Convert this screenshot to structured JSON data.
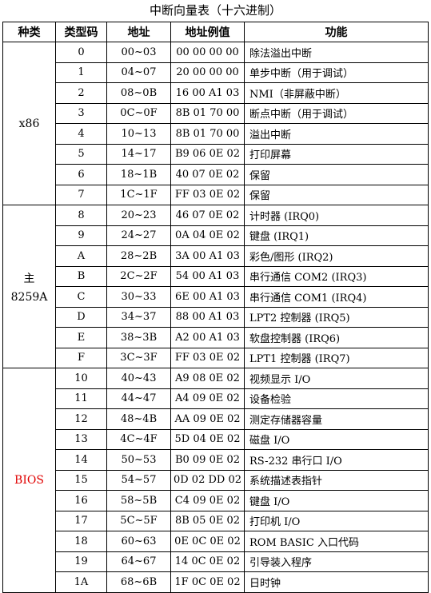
{
  "title": "中断向量表（十六进制）",
  "headers": [
    "种类",
    "类型码",
    "地址",
    "地址例值",
    "功能"
  ],
  "groups": [
    {
      "category_lines": [
        "x86"
      ],
      "color": "#000000",
      "rows": [
        {
          "code": "0",
          "addr": "00~03",
          "example": "00 00 00 00",
          "func": "除法溢出中断"
        },
        {
          "code": "1",
          "addr": "04~07",
          "example": "20 00 00 00",
          "func": "单步中断（用于调试）"
        },
        {
          "code": "2",
          "addr": "08~0B",
          "example": "16 00 A1 03",
          "func": "NMI（非屏蔽中断）"
        },
        {
          "code": "3",
          "addr": "0C~0F",
          "example": "8B 01 70 00",
          "func": "断点中断（用于调试）"
        },
        {
          "code": "4",
          "addr": "10~13",
          "example": "8B 01 70 00",
          "func": "溢出中断"
        },
        {
          "code": "5",
          "addr": "14~17",
          "example": "B9 06 0E 02",
          "func": "打印屏幕"
        },
        {
          "code": "6",
          "addr": "18~1B",
          "example": "40 07 0E 02",
          "func": "保留"
        },
        {
          "code": "7",
          "addr": "1C~1F",
          "example": "FF 03 0E 02",
          "func": "保留"
        }
      ]
    },
    {
      "category_lines": [
        "主",
        "8259A"
      ],
      "color": "#000000",
      "rows": [
        {
          "code": "8",
          "addr": "20~23",
          "example": "46 07 0E 02",
          "func": "计时器 (IRQ0)"
        },
        {
          "code": "9",
          "addr": "24~27",
          "example": "0A 04 0E 02",
          "func": "键盘 (IRQ1)"
        },
        {
          "code": "A",
          "addr": "28~2B",
          "example": "3A 00 A1 03",
          "func": "彩色/图形 (IRQ2)"
        },
        {
          "code": "B",
          "addr": "2C~2F",
          "example": "54 00 A1 03",
          "func": "串行通信 COM2 (IRQ3)"
        },
        {
          "code": "C",
          "addr": "30~33",
          "example": "6E 00 A1 03",
          "func": "串行通信 COM1 (IRQ4)"
        },
        {
          "code": "D",
          "addr": "34~37",
          "example": "88 00 A1 03",
          "func": "LPT2 控制器 (IRQ5)"
        },
        {
          "code": "E",
          "addr": "38~3B",
          "example": "A2 00 A1 03",
          "func": "软盘控制器 (IRQ6)"
        },
        {
          "code": "F",
          "addr": "3C~3F",
          "example": "FF 03 0E 02",
          "func": "LPT1 控制器 (IRQ7)"
        }
      ]
    },
    {
      "category_lines": [
        "BIOS"
      ],
      "color": "#e00000",
      "rows": [
        {
          "code": "10",
          "addr": "40~43",
          "example": "A9 08 0E 02",
          "func": "视频显示 I/O"
        },
        {
          "code": "11",
          "addr": "44~47",
          "example": "A4 09 0E 02",
          "func": "设备检验"
        },
        {
          "code": "12",
          "addr": "48~4B",
          "example": "AA 09 0E 02",
          "func": "测定存储器容量"
        },
        {
          "code": "13",
          "addr": "4C~4F",
          "example": "5D 04 0E 02",
          "func": "磁盘 I/O"
        },
        {
          "code": "14",
          "addr": "50~53",
          "example": "B0 09 0E 02",
          "func": "RS-232 串行口 I/O"
        },
        {
          "code": "15",
          "addr": "54~57",
          "example": "0D 02 DD 02",
          "func": "系统描述表指针"
        },
        {
          "code": "16",
          "addr": "58~5B",
          "example": "C4 09 0E 02",
          "func": "键盘 I/O"
        },
        {
          "code": "17",
          "addr": "5C~5F",
          "example": "8B 05 0E 02",
          "func": "打印机 I/O"
        },
        {
          "code": "18",
          "addr": "60~63",
          "example": "0E 0C 0E 02",
          "func": "ROM BASIC 入口代码"
        },
        {
          "code": "19",
          "addr": "64~67",
          "example": "14 0C 0E 02",
          "func": "引导装入程序"
        },
        {
          "code": "1A",
          "addr": "68~6B",
          "example": "1F 0C 0E 02",
          "func": "日时钟"
        }
      ]
    }
  ]
}
